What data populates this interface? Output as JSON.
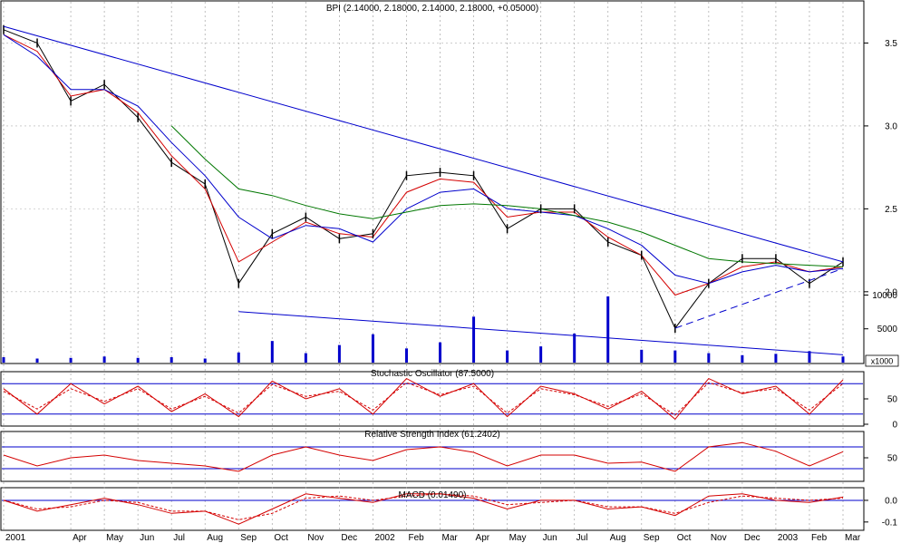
{
  "colors": {
    "price": "#000000",
    "ma_short": "#d40000",
    "ma_mid": "#0000cc",
    "ma_long": "#007700",
    "trendline": "#0000cc",
    "volume": "#0000cc",
    "osc_line": "#d40000",
    "osc_ref": "#0000cc",
    "grid": "#b0b0b0",
    "frame": "#000000"
  },
  "chart_data": [
    {
      "type": "line",
      "panel": "price",
      "title": "BPI (2.14000, 2.18000, 2.14000, 2.18000, +0.05000)",
      "ylim": [
        1.6,
        3.65
      ],
      "yticks": [
        2.0,
        2.5,
        3.0,
        3.5
      ],
      "ytick_labels": [
        "2.0",
        "2.5",
        "3.0",
        "3.5"
      ],
      "x": [
        "2001-02",
        "2001-03",
        "2001-04",
        "2001-05",
        "2001-06",
        "2001-07",
        "2001-08",
        "2001-09",
        "2001-10",
        "2001-11",
        "2001-12",
        "2002-01",
        "2002-02",
        "2002-03",
        "2002-04",
        "2002-05",
        "2002-06",
        "2002-07",
        "2002-08",
        "2002-09",
        "2002-10",
        "2002-11",
        "2002-12",
        "2003-01",
        "2003-02",
        "2003-03"
      ],
      "series": [
        {
          "role": "close",
          "values": [
            3.58,
            3.5,
            3.15,
            3.25,
            3.05,
            2.78,
            2.65,
            2.05,
            2.35,
            2.45,
            2.32,
            2.35,
            2.7,
            2.72,
            2.7,
            2.38,
            2.5,
            2.5,
            2.3,
            2.22,
            1.78,
            2.05,
            2.2,
            2.2,
            2.05,
            2.18
          ]
        },
        {
          "role": "ma_short",
          "values": [
            3.55,
            3.45,
            3.18,
            3.22,
            3.08,
            2.82,
            2.62,
            2.18,
            2.3,
            2.42,
            2.35,
            2.33,
            2.6,
            2.68,
            2.66,
            2.45,
            2.48,
            2.48,
            2.33,
            2.22,
            1.98,
            2.05,
            2.15,
            2.18,
            2.12,
            2.15
          ]
        },
        {
          "role": "ma_mid",
          "values": [
            3.55,
            3.42,
            3.22,
            3.22,
            3.12,
            2.9,
            2.7,
            2.45,
            2.32,
            2.4,
            2.38,
            2.3,
            2.5,
            2.6,
            2.62,
            2.5,
            2.48,
            2.46,
            2.38,
            2.28,
            2.1,
            2.05,
            2.12,
            2.16,
            2.12,
            2.14
          ]
        },
        {
          "role": "ma_long",
          "values": [
            null,
            null,
            null,
            null,
            null,
            3.0,
            2.8,
            2.62,
            2.58,
            2.52,
            2.47,
            2.44,
            2.48,
            2.52,
            2.53,
            2.52,
            2.5,
            2.46,
            2.42,
            2.36,
            2.28,
            2.2,
            2.18,
            2.17,
            2.16,
            2.15
          ]
        }
      ],
      "trendlines": [
        {
          "from": [
            "2001-02",
            3.6
          ],
          "to": [
            "2003-03",
            2.18
          ]
        },
        {
          "from": [
            "2001-09",
            1.88
          ],
          "to": [
            "2003-03",
            1.62
          ]
        },
        {
          "from": [
            "2002-10",
            1.78
          ],
          "to": [
            "2003-03",
            2.14
          ],
          "style": "dashed"
        }
      ]
    },
    {
      "type": "bar",
      "panel": "volume",
      "ylim": [
        0,
        11000
      ],
      "yticks": [
        5000,
        10000
      ],
      "ytick_labels": [
        "5000",
        "10000"
      ],
      "unit_label": "x1000",
      "x": [
        "2001-02",
        "2001-03",
        "2001-04",
        "2001-05",
        "2001-06",
        "2001-07",
        "2001-08",
        "2001-09",
        "2001-10",
        "2001-11",
        "2001-12",
        "2002-01",
        "2002-02",
        "2002-03",
        "2002-04",
        "2002-05",
        "2002-06",
        "2002-07",
        "2002-08",
        "2002-09",
        "2002-10",
        "2002-11",
        "2002-12",
        "2003-01",
        "2003-02",
        "2003-03"
      ],
      "values": [
        800,
        600,
        700,
        900,
        700,
        800,
        600,
        1500,
        3200,
        1400,
        2600,
        4200,
        2100,
        3000,
        6800,
        1800,
        2400,
        4300,
        9800,
        1900,
        1800,
        1400,
        1100,
        1300,
        1700,
        900
      ]
    },
    {
      "type": "line",
      "panel": "stochastic",
      "title": "Stochastic Oscillator (87.5000)",
      "ylim": [
        0,
        100
      ],
      "yticks": [
        0,
        50
      ],
      "ytick_labels": [
        "0",
        "50"
      ],
      "reference_lines": [
        20,
        80
      ],
      "x": [
        "2001-02",
        "2001-03",
        "2001-04",
        "2001-05",
        "2001-06",
        "2001-07",
        "2001-08",
        "2001-09",
        "2001-10",
        "2001-11",
        "2001-12",
        "2002-01",
        "2002-02",
        "2002-03",
        "2002-04",
        "2002-05",
        "2002-06",
        "2002-07",
        "2002-08",
        "2002-09",
        "2002-10",
        "2002-11",
        "2002-12",
        "2003-01",
        "2003-02",
        "2003-03"
      ],
      "series": [
        {
          "role": "k",
          "values": [
            70,
            20,
            80,
            40,
            75,
            25,
            60,
            15,
            85,
            50,
            70,
            20,
            90,
            55,
            80,
            15,
            75,
            60,
            30,
            65,
            10,
            90,
            60,
            75,
            20,
            87.5
          ]
        },
        {
          "role": "d",
          "style": "dashed",
          "values": [
            65,
            30,
            70,
            45,
            70,
            30,
            55,
            22,
            78,
            55,
            65,
            28,
            82,
            58,
            75,
            22,
            70,
            58,
            35,
            60,
            18,
            82,
            62,
            70,
            28,
            80
          ]
        }
      ]
    },
    {
      "type": "line",
      "panel": "rsi",
      "title": "Relative Strength Index (61.2402)",
      "ylim": [
        10,
        95
      ],
      "yticks": [
        50
      ],
      "ytick_labels": [
        "50"
      ],
      "reference_lines": [
        30,
        70
      ],
      "x": [
        "2001-02",
        "2001-03",
        "2001-04",
        "2001-05",
        "2001-06",
        "2001-07",
        "2001-08",
        "2001-09",
        "2001-10",
        "2001-11",
        "2001-12",
        "2002-01",
        "2002-02",
        "2002-03",
        "2002-04",
        "2002-05",
        "2002-06",
        "2002-07",
        "2002-08",
        "2002-09",
        "2002-10",
        "2002-11",
        "2002-12",
        "2003-01",
        "2003-02",
        "2003-03"
      ],
      "values": [
        55,
        35,
        50,
        55,
        45,
        40,
        35,
        25,
        55,
        70,
        55,
        45,
        65,
        70,
        60,
        35,
        55,
        55,
        40,
        42,
        25,
        70,
        78,
        62,
        35,
        61.2402
      ]
    },
    {
      "type": "line",
      "panel": "macd",
      "title": "MACD (0.01490)",
      "ylim": [
        -0.13,
        0.05
      ],
      "yticks": [
        0.0,
        -0.1
      ],
      "ytick_labels": [
        "0.0",
        "-0.1"
      ],
      "reference_lines": [
        0
      ],
      "x": [
        "2001-02",
        "2001-03",
        "2001-04",
        "2001-05",
        "2001-06",
        "2001-07",
        "2001-08",
        "2001-09",
        "2001-10",
        "2001-11",
        "2001-12",
        "2002-01",
        "2002-02",
        "2002-03",
        "2002-04",
        "2002-05",
        "2002-06",
        "2002-07",
        "2002-08",
        "2002-09",
        "2002-10",
        "2002-11",
        "2002-12",
        "2003-01",
        "2003-02",
        "2003-03"
      ],
      "series": [
        {
          "role": "macd",
          "values": [
            0.0,
            -0.05,
            -0.02,
            0.01,
            -0.02,
            -0.06,
            -0.05,
            -0.11,
            -0.04,
            0.03,
            0.01,
            -0.01,
            0.03,
            0.03,
            0.01,
            -0.04,
            0.0,
            0.0,
            -0.04,
            -0.03,
            -0.07,
            0.02,
            0.03,
            0.0,
            -0.01,
            0.0149
          ]
        },
        {
          "role": "signal",
          "style": "dashed",
          "values": [
            0.0,
            -0.04,
            -0.03,
            0.0,
            -0.01,
            -0.05,
            -0.05,
            -0.09,
            -0.06,
            0.01,
            0.02,
            0.0,
            0.02,
            0.03,
            0.02,
            -0.02,
            -0.01,
            0.0,
            -0.03,
            -0.03,
            -0.06,
            -0.01,
            0.02,
            0.01,
            0.0,
            0.01
          ]
        }
      ]
    }
  ],
  "x_axis": {
    "tick_labels": [
      "2001",
      "Apr",
      "May",
      "Jun",
      "Jul",
      "Aug",
      "Sep",
      "Oct",
      "Nov",
      "Dec",
      "2002",
      "Feb",
      "Mar",
      "Apr",
      "May",
      "Jun",
      "Jul",
      "Aug",
      "Sep",
      "Oct",
      "Nov",
      "Dec",
      "2003",
      "Feb",
      "Mar"
    ],
    "tick_months": [
      "2001-02",
      "2001-04",
      "2001-05",
      "2001-06",
      "2001-07",
      "2001-08",
      "2001-09",
      "2001-10",
      "2001-11",
      "2001-12",
      "2002-01",
      "2002-02",
      "2002-03",
      "2002-04",
      "2002-05",
      "2002-06",
      "2002-07",
      "2002-08",
      "2002-09",
      "2002-10",
      "2002-11",
      "2002-12",
      "2003-01",
      "2003-02",
      "2003-03"
    ]
  },
  "grid": true
}
